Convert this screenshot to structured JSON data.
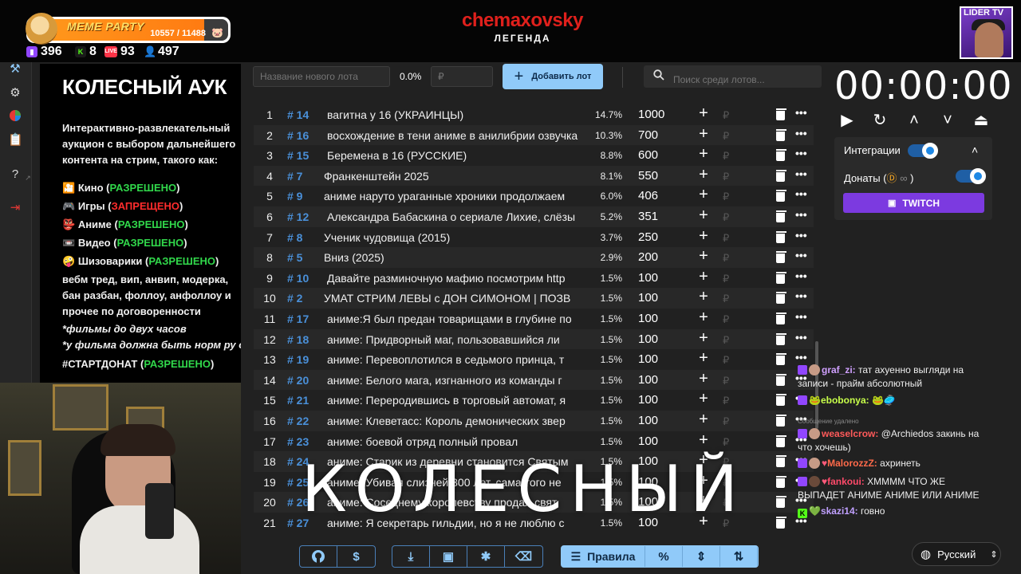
{
  "stream_bar": {
    "meme_title": "MEME PARTY",
    "meme_progress": "10557 / 11488",
    "meme_progress_fraction": 0.919,
    "brand": "chemaxovsky",
    "brand_sub": "ЛЕГЕНДА",
    "lider_label": "LIDER TV",
    "stats": [
      {
        "icon": "twitch-icon",
        "value": "396",
        "color": "#9146ff"
      },
      {
        "icon": "kick-icon",
        "value": "8",
        "color": "#53fc18"
      },
      {
        "icon": "vk-live-icon",
        "value": "93",
        "color": "#ff3347"
      },
      {
        "icon": "viewers-icon",
        "value": "497",
        "color": "#4aa3ff"
      }
    ]
  },
  "info": {
    "title": "КОЛЕСНЫЙ АУК",
    "intro": "Интерактивно-развлекательный аукцион с выбором дальнейшего контента на стрим, такого как:",
    "items": [
      {
        "emoji": "🎦",
        "label": "Кино (",
        "status": "РАЗРЕШЕНО",
        "ok": true
      },
      {
        "emoji": "🎮",
        "label": "Игры (",
        "status": "ЗАПРЕЩЕНО",
        "ok": false
      },
      {
        "emoji": "👺",
        "label": "Аниме (",
        "status": "РАЗРЕШЕНО",
        "ok": true
      },
      {
        "emoji": "📼",
        "label": "Видео (",
        "status": "РАЗРЕШЕНО",
        "ok": true
      },
      {
        "emoji": "🤪",
        "label": "Шизоварики (",
        "status": "РАЗРЕШЕНО",
        "ok": true
      }
    ],
    "extra": "вебм тред, вип, анвип, модерка, бан разбан, фоллоу, анфоллоу и прочее по договоренности",
    "note1": "*фильмы до двух часов",
    "note2": "*у фильма должна быть норм ру озвучка",
    "startdonat_label": "#СТАРТДОНАТ (",
    "startdonat_status": "РАЗРЕШЕНО",
    "close_paren": ")"
  },
  "toolbar": {
    "new_lot_placeholder": "Название нового лота",
    "percent": "0.0%",
    "price_placeholder": "₽",
    "add_lot_label": "Добавить лот",
    "search_placeholder": "Поиск среди лотов..."
  },
  "lots": [
    {
      "n": "1",
      "id": "# 14",
      "name": "вагитна у 16 (УКРАИНЦЫ)",
      "pct": "14.7%",
      "amount": "1000"
    },
    {
      "n": "2",
      "id": "# 16",
      "name": "восхождение в тени аниме в анилибрии озвучка",
      "pct": "10.3%",
      "amount": "700"
    },
    {
      "n": "3",
      "id": "# 15",
      "name": "Беремена в 16 (РУССКИЕ)",
      "pct": "8.8%",
      "amount": "600"
    },
    {
      "n": "4",
      "id": "# 7",
      "name": "Франкенштейн 2025",
      "pct": "8.1%",
      "amount": "550"
    },
    {
      "n": "5",
      "id": "# 9",
      "name": "аниме наруто ураганные хроники продолжаем",
      "pct": "6.0%",
      "amount": "406"
    },
    {
      "n": "6",
      "id": "# 12",
      "name": "Александра Бабаскина о сериале Лихие, слёзы",
      "pct": "5.2%",
      "amount": "351"
    },
    {
      "n": "7",
      "id": "# 8",
      "name": "Ученик чудовища (2015)",
      "pct": "3.7%",
      "amount": "250"
    },
    {
      "n": "8",
      "id": "# 5",
      "name": "Вниз (2025)",
      "pct": "2.9%",
      "amount": "200"
    },
    {
      "n": "9",
      "id": "# 10",
      "name": "Давайте разминочную мафию посмотрим http",
      "pct": "1.5%",
      "amount": "100"
    },
    {
      "n": "10",
      "id": "# 2",
      "name": "УМАТ СТРИМ ЛЕВЫ с ДОН СИМОНОМ | ПОЗВ",
      "pct": "1.5%",
      "amount": "100"
    },
    {
      "n": "11",
      "id": "# 17",
      "name": "аниме:Я был предан товарищами в глубине по",
      "pct": "1.5%",
      "amount": "100"
    },
    {
      "n": "12",
      "id": "# 18",
      "name": "аниме: Придворный маг, пользовавшийся ли",
      "pct": "1.5%",
      "amount": "100"
    },
    {
      "n": "13",
      "id": "# 19",
      "name": "аниме: Перевоплотился в седьмого принца, т",
      "pct": "1.5%",
      "amount": "100"
    },
    {
      "n": "14",
      "id": "# 20",
      "name": "аниме: Белого мага, изгнанного из команды г",
      "pct": "1.5%",
      "amount": "100"
    },
    {
      "n": "15",
      "id": "# 21",
      "name": "аниме: Переродившись в торговый автомат, я",
      "pct": "1.5%",
      "amount": "100"
    },
    {
      "n": "16",
      "id": "# 22",
      "name": "аниме: Клеветасс: Король демонических звер",
      "pct": "1.5%",
      "amount": "100"
    },
    {
      "n": "17",
      "id": "# 23",
      "name": "аниме: боевой отряд полный провал",
      "pct": "1.5%",
      "amount": "100"
    },
    {
      "n": "18",
      "id": "# 24",
      "name": "аниме: Старик из деревни становится Святым",
      "pct": "1.5%",
      "amount": "100"
    },
    {
      "n": "19",
      "id": "# 25",
      "name": "аниме: Убивая слизней 300 лет, сама того не",
      "pct": "1.5%",
      "amount": "100"
    },
    {
      "n": "20",
      "id": "# 26",
      "name": "аниме: Соседнему королевству продал свят",
      "pct": "1.5%",
      "amount": "100"
    },
    {
      "n": "21",
      "id": "# 27",
      "name": "аниме: Я секретарь гильдии, но я не люблю с",
      "pct": "1.5%",
      "amount": "100"
    }
  ],
  "row_symbols": {
    "plus": "+",
    "rub": "₽",
    "more": "•••"
  },
  "overlay_text": "КОЛЕСНЫЙ",
  "bottom_toolbar": {
    "group1": [
      {
        "icon": "github-icon",
        "glyph": "◉"
      },
      {
        "icon": "dollar-icon",
        "glyph": "$"
      }
    ],
    "group2": [
      {
        "icon": "download-icon",
        "glyph": "⤓"
      },
      {
        "icon": "save-icon",
        "glyph": "▣"
      },
      {
        "icon": "bug-icon",
        "glyph": "✱"
      },
      {
        "icon": "clear-icon",
        "glyph": "⌫"
      }
    ],
    "rules_label": "Правила",
    "group3": [
      {
        "icon": "percent-icon",
        "glyph": "%"
      },
      {
        "icon": "sort-icon",
        "glyph": "⇕"
      },
      {
        "icon": "swap-icon",
        "glyph": "⇅"
      }
    ]
  },
  "timer": {
    "value": "00:00:00",
    "controls": [
      {
        "icon": "play-icon",
        "glyph": "▶"
      },
      {
        "icon": "reset-icon",
        "glyph": "↻"
      },
      {
        "icon": "increase-icon",
        "glyph": "˄"
      },
      {
        "icon": "decrease-icon",
        "glyph": "˅"
      },
      {
        "icon": "collapse-icon",
        "glyph": "⏏"
      }
    ]
  },
  "integrations": {
    "label": "Интеграции",
    "donations_label": "Донаты (",
    "donations_close": ")",
    "twitch_label": "TWITCH"
  },
  "chat": [
    {
      "user": "graf_zi:",
      "user_color": "#d0a0ff",
      "text": "тат ахуенно выгляди на записи - прайм абсолютный"
    },
    {
      "user": "ebobonya:",
      "user_color": "#c8ff4a",
      "text": ""
    },
    {
      "user": "",
      "user_color": "#888",
      "text": "Сообщение удалено"
    },
    {
      "user": "weaselcrow:",
      "user_color": "#ff5a5a",
      "text": "@Archiedos закинь на что хочешь)"
    },
    {
      "user": "MalorozzZ:",
      "user_color": "#ff6a4a",
      "text": "ахринеть"
    },
    {
      "user": "fankoui:",
      "user_color": "#ff4a6a",
      "text": "ХММММ ЧТО ЖЕ ВЫПАДЕТ АНИМЕ АНИМЕ ИЛИ АНИМЕ"
    },
    {
      "user": "skazi14:",
      "user_color": "#c0a0ff",
      "text": "говно"
    }
  ],
  "language": {
    "label": "Русский"
  }
}
